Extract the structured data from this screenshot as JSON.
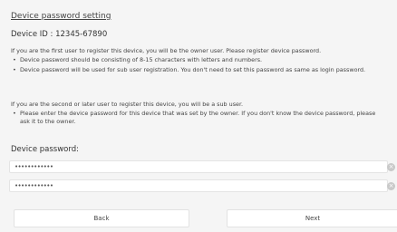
{
  "page": {
    "title": "Device password setting",
    "device_id": "Device ID : 12345-67890"
  },
  "owner_section": {
    "intro": "If you are the first user to register this device, you will be the owner user. Please register device password.",
    "bullets": [
      "Device password should be consisting of 8-15 characters with letters and numbers.",
      "Device password will be used for sub user registration. You don't need to set this password as same as login password."
    ]
  },
  "sub_section": {
    "intro": "If you are the second or later user to register this device, you will be a sub user.",
    "bullets": [
      "Please enter the device password for this device that was set by the owner. If you don't know the device password, please ask it to the owner."
    ]
  },
  "form": {
    "label": "Device password:",
    "password_value": "••••••••••••",
    "confirm_value": "••••••••••••",
    "clear_icon": "clear-icon"
  },
  "buttons": {
    "back": "Back",
    "next": "Next"
  }
}
